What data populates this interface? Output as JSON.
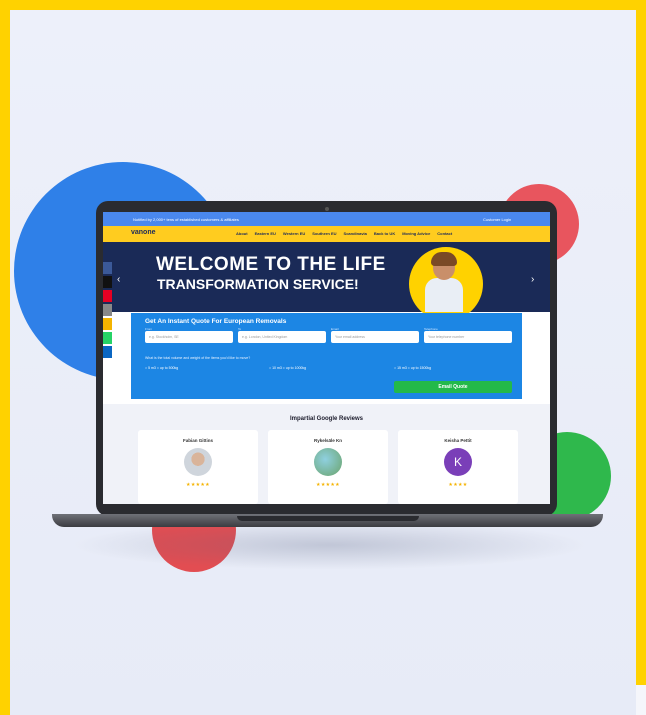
{
  "site": {
    "topbar_text": "Notified by 2,000+ tens of established customers & affiliates",
    "login": "Customer Login",
    "logo": "vanone",
    "nav": [
      "About",
      "Eastern EU",
      "Western EU",
      "Southern EU",
      "Scandinavia",
      "Back to UK",
      "Moving Advice",
      "Contact"
    ]
  },
  "hero": {
    "line1": "WELCOME TO THE LIFE",
    "line2": "TRANSFORMATION SERVICE!",
    "prev_arrow": "‹",
    "next_arrow": "›"
  },
  "quote": {
    "title": "Get An Instant Quote For European Removals",
    "fields": [
      {
        "label": "From",
        "placeholder": "e.g. Stockholm, SE"
      },
      {
        "label": "To",
        "placeholder": "e.g. London, United Kingdom"
      },
      {
        "label": "Email",
        "placeholder": "Your email address"
      },
      {
        "label": "Telephone",
        "placeholder": "Your telephone number"
      }
    ],
    "note": "What is the total volume and weight of the items you'd like to move?",
    "options": [
      "5 m3 = up to 500kg",
      "10 m3 = up to 1000kg",
      "15 m3 = up to 1500kg"
    ],
    "button": "Email Quote"
  },
  "reviews": {
    "title": "Impartial Google Reviews",
    "cards": [
      {
        "name": "Fabian Gittins",
        "stars": "★★★★★",
        "avatar_letter": ""
      },
      {
        "name": "Rykelsäle Kn",
        "stars": "★★★★★",
        "avatar_letter": ""
      },
      {
        "name": "Keisha Pettit",
        "stars": "★★★★",
        "avatar_letter": "K"
      }
    ]
  },
  "colors": {
    "frame_yellow": "#ffd200",
    "site_blue": "#1c86e4",
    "hero_navy": "#1a2a57",
    "nav_yellow": "#ffcc1f",
    "button_green": "#23b94a"
  }
}
